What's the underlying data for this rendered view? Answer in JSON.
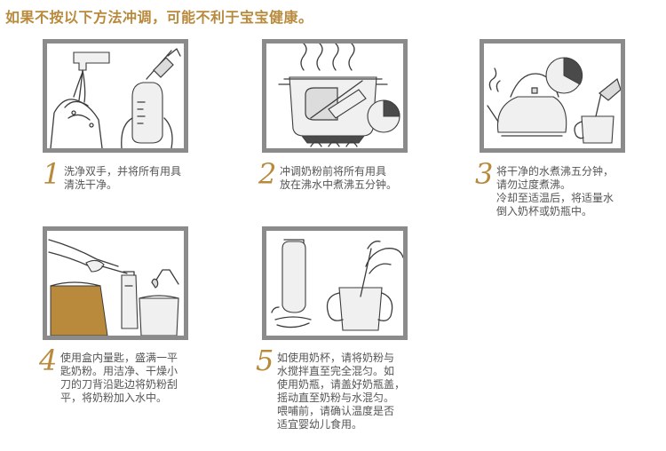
{
  "header": {
    "title": "如果不按以下方法冲调，可能不利于宝宝健康。"
  },
  "colors": {
    "accent": "#b98a3c",
    "frame": "#8b8b8b",
    "text": "#555555"
  },
  "steps": [
    {
      "number": "1",
      "lines": [
        "洗净双手，并将所有用具",
        "清洗干净。"
      ]
    },
    {
      "number": "2",
      "lines": [
        "冲调奶粉前将所有用具",
        "放在沸水中煮沸五分钟。"
      ]
    },
    {
      "number": "3",
      "lines": [
        "将干净的水煮沸五分钟，",
        "请勿过度煮沸。",
        "冷却至适温后，将适量水",
        "倒入奶杯或奶瓶中。"
      ]
    },
    {
      "number": "4",
      "lines": [
        "使用盒内量匙，盛满一平",
        "匙奶粉。用洁净、干燥小",
        "刀的刀背沿匙边将奶粉刮",
        "平，将奶粉加入水中。"
      ]
    },
    {
      "number": "5",
      "lines": [
        "如使用奶杯，请将奶粉与",
        "水搅拌直至完全混匀。如",
        "使用奶瓶，请盖好奶瓶盖，",
        "摇动直至奶粉与水混匀。",
        "喂哺前，请确认温度是否",
        "适宜婴幼儿食用。"
      ]
    }
  ]
}
